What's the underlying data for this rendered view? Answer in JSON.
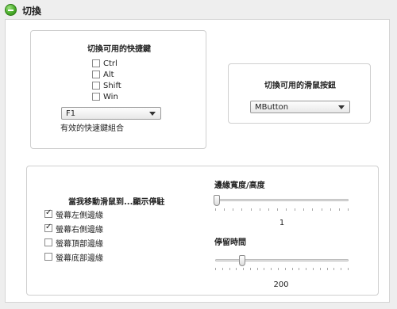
{
  "header": {
    "title": "切換",
    "icon": "toggle-minus-icon"
  },
  "hotkey_panel": {
    "title": "切換可用的快捷鍵",
    "modifiers": [
      {
        "label": "Ctrl",
        "checked": false
      },
      {
        "label": "Alt",
        "checked": false
      },
      {
        "label": "Shift",
        "checked": false
      },
      {
        "label": "Win",
        "checked": false
      }
    ],
    "key_select": {
      "value": "F1"
    },
    "note": "有效的快速鍵組合"
  },
  "mouse_panel": {
    "title": "切換可用的滑鼠按鈕",
    "button_select": {
      "value": "MButton"
    }
  },
  "edge_panel": {
    "title": "當我移動滑鼠到...顯示停駐",
    "edges": [
      {
        "label": "螢幕左側邊緣",
        "checked": true
      },
      {
        "label": "螢幕右側邊緣",
        "checked": true
      },
      {
        "label": "螢幕頂部邊緣",
        "checked": false
      },
      {
        "label": "螢幕底部邊緣",
        "checked": false
      }
    ],
    "width_slider": {
      "label": "邊緣寬度/高度",
      "value": "1"
    },
    "delay_slider": {
      "label": "停留時間",
      "value": "200"
    }
  },
  "colors": {
    "accent_green": "#4cae2d",
    "panel_border": "#cfcfcf",
    "background": "#eeeeee"
  }
}
